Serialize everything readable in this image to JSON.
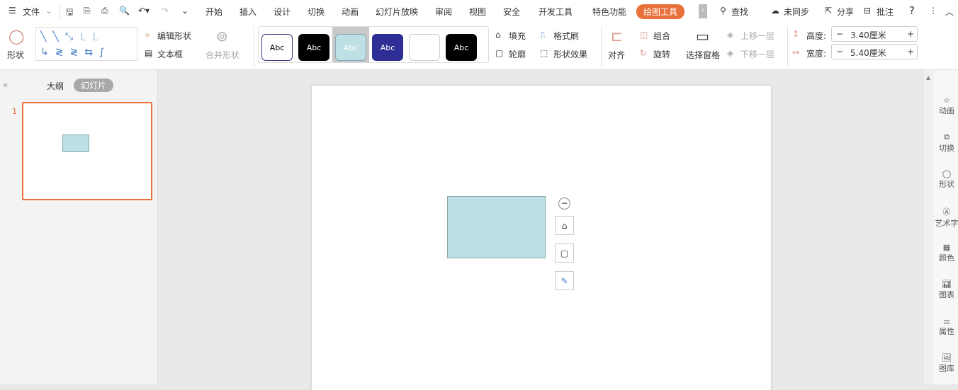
{
  "menubar": {
    "file": "文件",
    "tabs": [
      "开始",
      "插入",
      "设计",
      "切换",
      "动画",
      "幻灯片放映",
      "审阅",
      "视图",
      "安全",
      "开发工具",
      "特色功能"
    ],
    "active_tab": "绘图工具",
    "search": "查找",
    "sync": "未同步",
    "share": "分享",
    "comment": "批注",
    "help": "?"
  },
  "ribbon": {
    "shape": "形状",
    "edit_shape": "编辑形状",
    "text_box": "文本框",
    "merge_shape": "合并形状",
    "styles": [
      "Abc",
      "Abc",
      "Abc",
      "Abc",
      "",
      "Abc"
    ],
    "fill": "填充",
    "format_painter": "格式刷",
    "outline": "轮廓",
    "shape_effect": "形状效果",
    "align": "对齐",
    "group": "组合",
    "rotate": "旋转",
    "selection_pane": "选择窗格",
    "bring_forward": "上移一层",
    "send_backward": "下移一层",
    "height_label": "高度:",
    "height_value": "3.40厘米",
    "width_label": "宽度:",
    "width_value": "5.40厘米"
  },
  "leftpanel": {
    "tab_outline": "大纲",
    "tab_slides": "幻灯片",
    "slide_number": "1"
  },
  "rightpanel": {
    "items": [
      "动画",
      "切换",
      "形状",
      "艺术字",
      "颜色",
      "图表",
      "属性",
      "图库"
    ]
  },
  "colors": {
    "accent": "#e8703a",
    "shape_fill": "#bce0e4",
    "selected_border": "#e8703a"
  }
}
